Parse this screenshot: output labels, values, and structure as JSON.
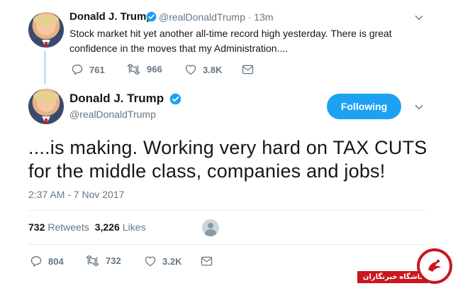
{
  "colors": {
    "accent": "#1da1f2",
    "muted_text": "#657786",
    "primary_text": "#14171a",
    "verified": "#1da1f2",
    "thread_line": "#c4e3f8",
    "watermark_red": "#c9171e"
  },
  "reply_tweet": {
    "name": "Donald J. Trump",
    "handle_time": "@realDonaldTrump · 13m",
    "text": "Stock market hit yet another all-time record high yesterday. There is great confidence in the moves that my Administration....",
    "actions": {
      "replies": "761",
      "retweets": "966",
      "likes": "3.8K"
    },
    "icons": [
      "reply-icon",
      "retweet-icon",
      "like-icon",
      "message-icon",
      "chevron-down-icon",
      "verified-icon"
    ]
  },
  "main_tweet": {
    "name": "Donald J. Trump",
    "handle": "@realDonaldTrump",
    "follow_label": "Following",
    "text": "....is making. Working very hard on TAX CUTS for the middle class, companies and jobs!",
    "timestamp": "2:37 AM - 7 Nov 2017",
    "stats": {
      "retweets_count": "732",
      "retweets_label": "Retweets",
      "likes_count": "3,226",
      "likes_label": "Likes"
    },
    "actions": {
      "replies": "804",
      "retweets": "732",
      "likes": "3.2K"
    }
  },
  "watermark": {
    "text": "باشگاه خبرنگاران"
  }
}
